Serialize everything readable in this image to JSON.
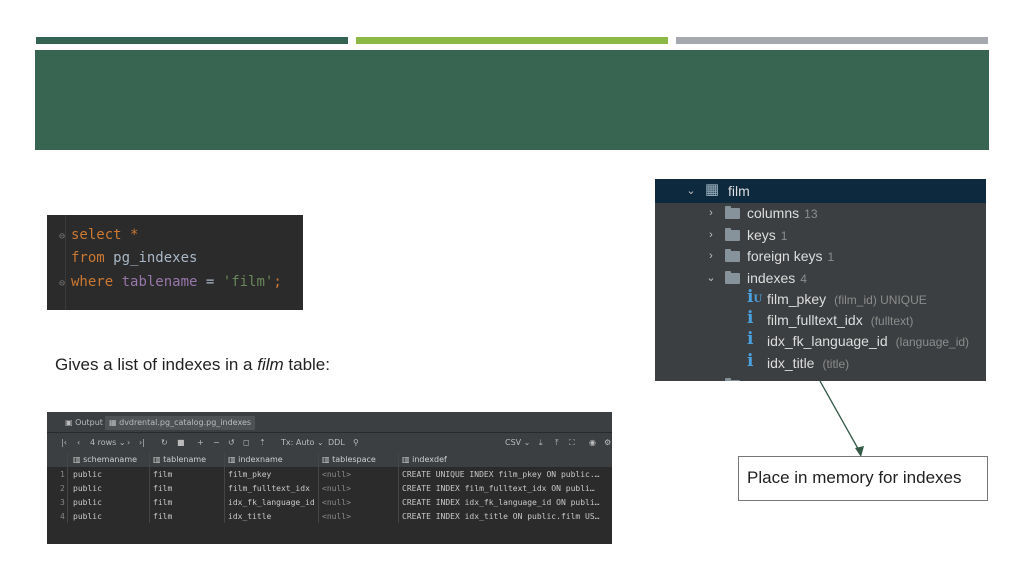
{
  "code": {
    "line1": {
      "kw": "select",
      "rest": "*"
    },
    "line2": {
      "kw": "from",
      "rest": "pg_indexes"
    },
    "line3": {
      "kw": "where",
      "col": "tablename",
      "op": "=",
      "str": "'film'",
      "end": ";"
    }
  },
  "caption": {
    "pre": "Gives a list of indexes in a ",
    "em": "film",
    "post": " table:"
  },
  "result": {
    "tabs": [
      "Output",
      "dvdrental.pg_catalog.pg_indexes"
    ],
    "toolbar": {
      "rows": "4 rows",
      "tx": "Tx: Auto",
      "ddl": "DDL",
      "export": "CSV"
    },
    "columns": [
      "schemaname",
      "tablename",
      "indexname",
      "tablespace",
      "indexdef"
    ],
    "rows": [
      {
        "n": "1",
        "schemaname": "public",
        "tablename": "film",
        "indexname": "film_pkey",
        "tablespace": "<null>",
        "indexdef": "CREATE UNIQUE INDEX film_pkey ON public.…"
      },
      {
        "n": "2",
        "schemaname": "public",
        "tablename": "film",
        "indexname": "film_fulltext_idx",
        "tablespace": "<null>",
        "indexdef": "CREATE INDEX film_fulltext_idx ON publi…"
      },
      {
        "n": "3",
        "schemaname": "public",
        "tablename": "film",
        "indexname": "idx_fk_language_id",
        "tablespace": "<null>",
        "indexdef": "CREATE INDEX idx_fk_language_id ON publi…"
      },
      {
        "n": "4",
        "schemaname": "public",
        "tablename": "film",
        "indexname": "idx_title",
        "tablespace": "<null>",
        "indexdef": "CREATE INDEX idx_title ON public.film US…"
      }
    ]
  },
  "tree": {
    "table": "film",
    "folders": [
      {
        "label": "columns",
        "count": "13"
      },
      {
        "label": "keys",
        "count": "1"
      },
      {
        "label": "foreign keys",
        "count": "1"
      },
      {
        "label": "indexes",
        "count": "4"
      }
    ],
    "indexes": [
      {
        "name": "film_pkey",
        "detail": "(film_id) UNIQUE"
      },
      {
        "name": "film_fulltext_idx",
        "detail": "(fulltext)"
      },
      {
        "name": "idx_fk_language_id",
        "detail": "(language_id)"
      },
      {
        "name": "idx_title",
        "detail": "(title)"
      }
    ]
  },
  "callout": "Place in memory for indexes",
  "colors": {
    "banner": "#386452",
    "bar_green": "#8cba45",
    "bar_gray": "#a5a9ae",
    "selection": "#0d293e",
    "index_icon": "#4a9fdd"
  }
}
